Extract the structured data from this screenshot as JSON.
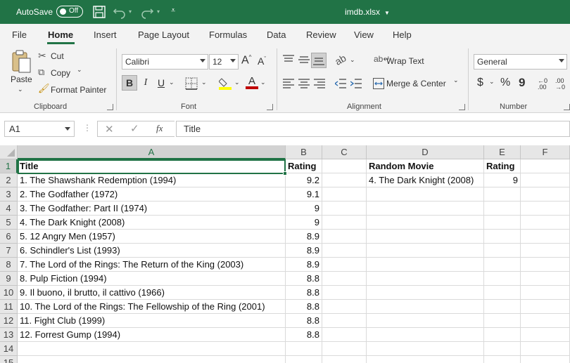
{
  "titlebar": {
    "autosave_label": "AutoSave",
    "toggle_state": "Off",
    "filename": "imdb.xlsx"
  },
  "menu": {
    "tabs": [
      "File",
      "Home",
      "Insert",
      "Page Layout",
      "Formulas",
      "Data",
      "Review",
      "View",
      "Help"
    ],
    "active": "Home"
  },
  "ribbon": {
    "clipboard": {
      "paste": "Paste",
      "cut": "Cut",
      "copy": "Copy",
      "format_painter": "Format Painter",
      "label": "Clipboard"
    },
    "font": {
      "name": "Calibri",
      "size": "12",
      "grow": "A",
      "shrink": "A",
      "bold": "B",
      "italic": "I",
      "underline": "U",
      "font_color_letter": "A",
      "label": "Font"
    },
    "alignment": {
      "wrap_text": "Wrap Text",
      "merge_center": "Merge & Center",
      "label": "Alignment"
    },
    "number": {
      "format": "General",
      "currency": "$",
      "percent": "%",
      "comma": "9",
      "label": "Number"
    },
    "colors": {
      "accent": "#217346",
      "highlight": "#ffff00",
      "font_color": "#c00000"
    }
  },
  "formula_bar": {
    "cell_ref": "A1",
    "fx": "fx",
    "content": "Title"
  },
  "sheet": {
    "columns": [
      "A",
      "B",
      "C",
      "D",
      "E",
      "F"
    ],
    "selected_column": "A",
    "selected_row": "1",
    "rows": [
      {
        "n": "1",
        "A": "Title",
        "B": "Rating",
        "C": "",
        "D": "Random Movie",
        "E": "Rating",
        "F": ""
      },
      {
        "n": "2",
        "A": "1. The Shawshank Redemption (1994)",
        "B": "9.2",
        "C": "",
        "D": "4. The Dark Knight (2008)",
        "E": "9",
        "F": ""
      },
      {
        "n": "3",
        "A": "2. The Godfather (1972)",
        "B": "9.1",
        "C": "",
        "D": "",
        "E": "",
        "F": ""
      },
      {
        "n": "4",
        "A": "3. The Godfather: Part II (1974)",
        "B": "9",
        "C": "",
        "D": "",
        "E": "",
        "F": ""
      },
      {
        "n": "5",
        "A": "4. The Dark Knight (2008)",
        "B": "9",
        "C": "",
        "D": "",
        "E": "",
        "F": ""
      },
      {
        "n": "6",
        "A": "5. 12 Angry Men (1957)",
        "B": "8.9",
        "C": "",
        "D": "",
        "E": "",
        "F": ""
      },
      {
        "n": "7",
        "A": "6. Schindler's List (1993)",
        "B": "8.9",
        "C": "",
        "D": "",
        "E": "",
        "F": ""
      },
      {
        "n": "8",
        "A": "7. The Lord of the Rings: The Return of the King (2003)",
        "B": "8.9",
        "C": "",
        "D": "",
        "E": "",
        "F": ""
      },
      {
        "n": "9",
        "A": "8. Pulp Fiction (1994)",
        "B": "8.8",
        "C": "",
        "D": "",
        "E": "",
        "F": ""
      },
      {
        "n": "10",
        "A": "9. Il buono, il brutto, il cattivo (1966)",
        "B": "8.8",
        "C": "",
        "D": "",
        "E": "",
        "F": ""
      },
      {
        "n": "11",
        "A": "10. The Lord of the Rings: The Fellowship of the Ring (2001)",
        "B": "8.8",
        "C": "",
        "D": "",
        "E": "",
        "F": ""
      },
      {
        "n": "12",
        "A": "11. Fight Club (1999)",
        "B": "8.8",
        "C": "",
        "D": "",
        "E": "",
        "F": ""
      },
      {
        "n": "13",
        "A": "12. Forrest Gump (1994)",
        "B": "8.8",
        "C": "",
        "D": "",
        "E": "",
        "F": ""
      },
      {
        "n": "14",
        "A": "",
        "B": "",
        "C": "",
        "D": "",
        "E": "",
        "F": ""
      },
      {
        "n": "15",
        "A": "",
        "B": "",
        "C": "",
        "D": "",
        "E": "",
        "F": ""
      }
    ]
  }
}
